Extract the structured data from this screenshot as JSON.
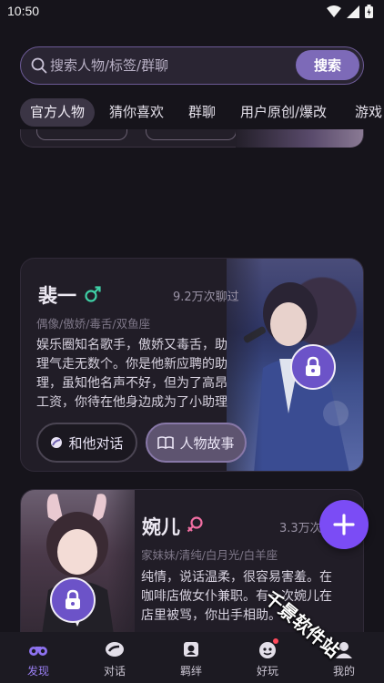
{
  "status": {
    "time": "10:50"
  },
  "search": {
    "placeholder": "搜索人物/标签/群聊",
    "button_label": "搜索"
  },
  "tabs": [
    {
      "label": "官方人物",
      "active": true
    },
    {
      "label": "猜你喜欢"
    },
    {
      "label": "群聊"
    },
    {
      "label": "用户原创/爆改"
    },
    {
      "label": "游戏"
    }
  ],
  "cards": [
    {
      "name": "裴一",
      "gender": "male",
      "chat_count": "9.2万次聊过",
      "tags": "偶像/傲娇/毒舌/双鱼座",
      "desc_lines": [
        "娱乐圈知名歌手，傲娇又毒舌，助",
        "理气走无数个。你是他新应聘的助",
        "理，虽知他名声不好，但为了高昂",
        "工资，你待在他身边成为了小助理"
      ],
      "chat_button": "和他对话",
      "story_button": "人物故事"
    },
    {
      "name": "婉儿",
      "gender": "female",
      "chat_count": "3.3万次",
      "tags": "家妹妹/清纯/白月光/白羊座",
      "desc_lines": [
        "纯情，说话温柔，很容易害羞。在",
        "咖啡店做女仆兼职。有一次婉儿在",
        "店里被骂，你出手相助。"
      ]
    }
  ],
  "nav": [
    {
      "label": "发现",
      "icon": "binoculars-icon",
      "active": true
    },
    {
      "label": "对话",
      "icon": "chat-icon"
    },
    {
      "label": "羁绊",
      "icon": "card-icon"
    },
    {
      "label": "好玩",
      "icon": "game-icon",
      "badge": true
    },
    {
      "label": "我的",
      "icon": "profile-icon"
    }
  ],
  "watermark": "千景软件站",
  "colors": {
    "accent": "#7b4cf5",
    "lock": "#6c53c8",
    "nav_active": "#9a7ff2",
    "background": "#16141b"
  }
}
